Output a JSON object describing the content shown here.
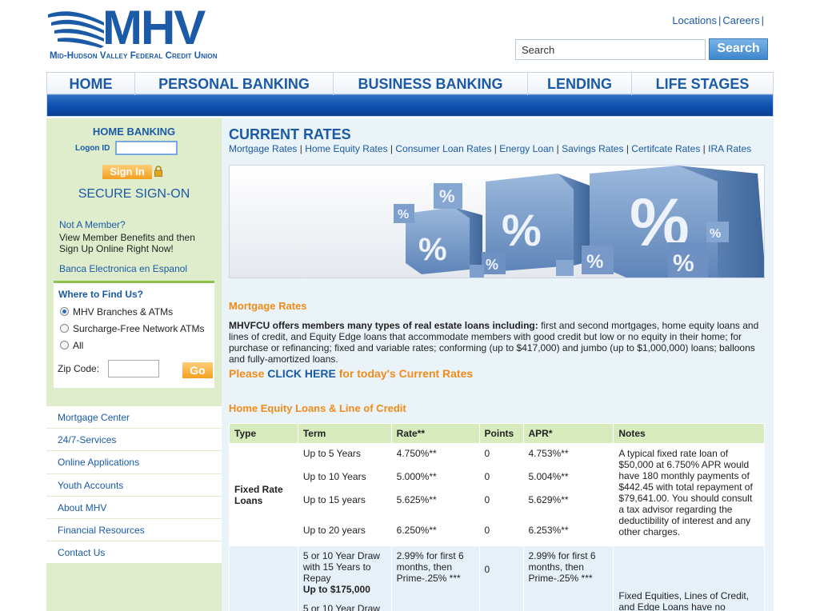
{
  "header": {
    "logo_text": "MHV",
    "logo_subtitle": "Mid-Hudson Valley Federal Credit Union",
    "top_links": [
      "Locations",
      "Careers"
    ],
    "search": {
      "value": "Search",
      "button_label": "Search"
    }
  },
  "nav": {
    "items": [
      "HOME",
      "PERSONAL BANKING",
      "BUSINESS BANKING",
      "LENDING",
      "LIFE STAGES"
    ]
  },
  "sidebar": {
    "home_banking_title": "HOME BANKING",
    "logon_label": "Logon ID",
    "signin_label": "Sign In",
    "secure_signon": "SECURE SIGN-ON",
    "not_member": "Not A Member?",
    "member_benefits": "View Member Benefits and then Sign Up Online Right Now!",
    "banca": "Banca Electronica en Espanol",
    "find_title": "Where to Find Us?",
    "radio_options": [
      "MHV Branches & ATMs",
      "Surcharge-Free Network ATMs",
      "All"
    ],
    "selected_option": "MHV Branches & ATMs",
    "zip_label": "Zip Code:",
    "go_label": "Go",
    "menu": [
      "Mortgage Center",
      "24/7-Services",
      "Online Applications",
      "Youth Accounts",
      "About MHV",
      "Financial Resources",
      "Contact Us"
    ]
  },
  "main": {
    "title": "CURRENT RATES",
    "rate_links": [
      "Mortgage Rates",
      "Home Equity Rates",
      "Consumer Loan Rates",
      "Energy Loan",
      "Savings Rates",
      "Certifcate Rates",
      "IRA Rates"
    ],
    "mortgage_heading": "Mortgage Rates",
    "mortgage_intro_bold": "MHVFCU offers members many types of real estate loans including:",
    "mortgage_intro_rest": " first and second mortgages, home equity loans and lines of credit, and Equity Edge loans that accommodate members with good credit but low or no equity in their home; for purchase or refinancing; fixed and variable rates; conforming (up to $417,000) and jumbo (up to $1,000,000) loans; balloons and fully-amortized loans.",
    "cta_prefix": "Please ",
    "cta_link": "CLICK HERE",
    "cta_suffix": " for today's Current Rates",
    "heloc_heading": "Home Equity Loans & Line of Credit",
    "table": {
      "headers": [
        "Type",
        "Term",
        "Rate**",
        "Points",
        "APR*",
        "Notes"
      ],
      "fixed_type": "Fixed Rate Loans",
      "fixed_rows": [
        {
          "term": "Up to 5 Years",
          "rate": "4.750%**",
          "points": "0",
          "apr": "4.753%**"
        },
        {
          "term": "Up to 10 Years",
          "rate": "5.000%**",
          "points": "0",
          "apr": "5.004%**"
        },
        {
          "term": "Up to 15 years",
          "rate": "5.625%**",
          "points": "0",
          "apr": "5.629%**"
        },
        {
          "term": "Up to 20 years",
          "rate": "6.250%**",
          "points": "0",
          "apr": "6.253%**"
        }
      ],
      "fixed_note": "A typical fixed rate loan of $50,000 at 6.750% APR would have 180 monthly payments of $442.45 with total repayment of $79,641.00. You should consult a tax advisor regarding the deductibility of interest and any other charges.",
      "loc_term": "5 or 10 Year Draw with 15 Years to Repay",
      "loc_term_bold": "Up to $175,000",
      "loc_rate": "2.99% for first 6 months, then Prime-.25% ***",
      "loc_points": "0",
      "loc_apr": "2.99% for first 6 months, then Prime-.25% ***",
      "loc_term_2": "5 or 10 Year Draw",
      "loc_note": "Fixed Equities, Lines of Credit, and Edge Loans have no"
    }
  }
}
